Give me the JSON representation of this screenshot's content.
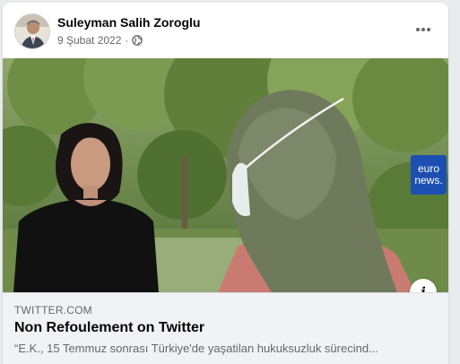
{
  "post": {
    "author": "Suleyman Salih Zoroglu",
    "date": "9 Şubat 2022",
    "separator": "·",
    "privacy_icon": "globe-icon",
    "menu_icon": "more-horizontal-icon"
  },
  "video": {
    "watermark_line1": "euro",
    "watermark_line2": "news.",
    "info_label": "i"
  },
  "link": {
    "domain": "TWITTER.COM",
    "title": "Non Refoulement on Twitter",
    "description": "“E.K., 15 Temmuz sonrası Türkiye'de yaşatilan hukuksuzluk sürecind..."
  },
  "colors": {
    "watermark_bg": "#1d4fb3",
    "preview_bg": "#f0f2f5",
    "secondary_text": "#65676b"
  }
}
